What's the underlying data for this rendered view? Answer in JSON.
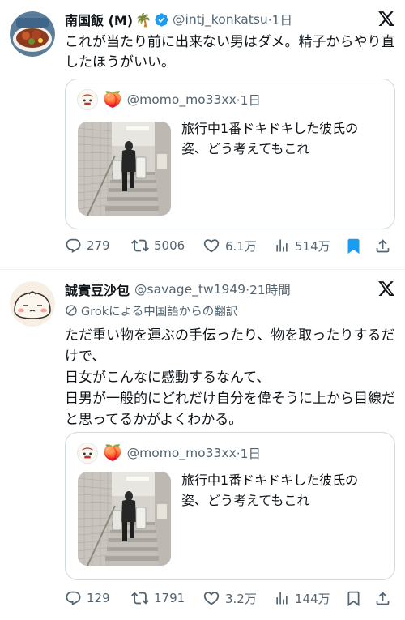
{
  "colors": {
    "accent": "#1d9bf0",
    "text_primary": "#0f1419",
    "text_secondary": "#536471",
    "border": "#cfd9de",
    "verified": "#1d9bf0"
  },
  "tweets": [
    {
      "author_name": "南国飯 (M)",
      "author_emoji": "🌴",
      "verified": true,
      "handle": "@intj_konkatsu",
      "time": "·1日",
      "text": "これが当たり前に出来ない男はダメ。精子からやり直したほうがいい。",
      "quote": {
        "handle": "@momo_mo33xx",
        "time": "·1日",
        "emoji": "🍑",
        "text": "旅行中1番ドキドキした彼氏の姿、どう考えてもこれ"
      },
      "actions": {
        "replies": "279",
        "retweets": "5006",
        "likes": "6.1万",
        "views": "514万",
        "bookmarked": true
      }
    },
    {
      "author_name": "誠實豆沙包",
      "handle": "@savage_tw1949",
      "time": "·21時間",
      "translation_note": "Grokによる中国語からの翻訳",
      "text": "ただ重い物を運ぶの手伝ったり、物を取ったりするだけで、\n日女がこんなに感動するなんて、\n日男が一般的にどれだけ自分を偉そうに上から目線だと思ってるかがよくわかる。",
      "quote": {
        "handle": "@momo_mo33xx",
        "time": "·1日",
        "emoji": "🍑",
        "text": "旅行中1番ドキドキした彼氏の姿、どう考えてもこれ"
      },
      "actions": {
        "replies": "129",
        "retweets": "1791",
        "likes": "3.2万",
        "views": "144万",
        "bookmarked": false
      }
    }
  ],
  "icons": [
    "x-logo-icon",
    "verified-badge-icon",
    "translate-icon",
    "reply-icon",
    "retweet-icon",
    "like-icon",
    "views-icon",
    "bookmark-icon",
    "share-icon"
  ]
}
